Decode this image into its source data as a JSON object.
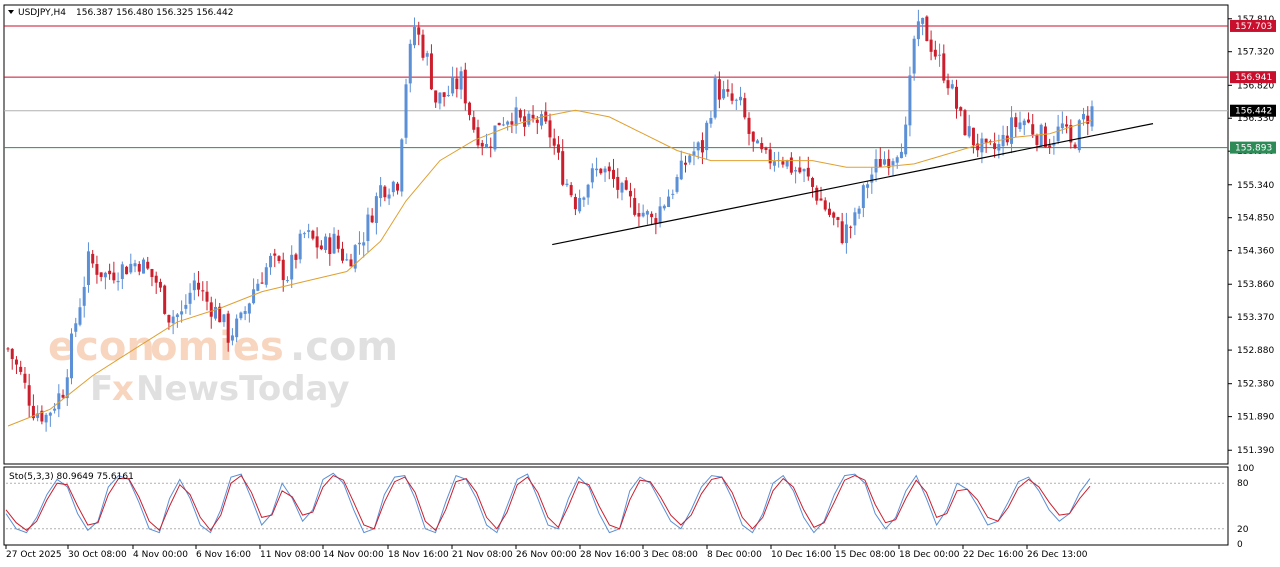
{
  "header": {
    "symbol": "USDJPY,H4",
    "ohlc": "156.387 156.480 156.325 156.442",
    "menu_icon": "triangle-down-icon"
  },
  "watermark": {
    "line1_a": "econ",
    "line1_b": "omies",
    "line1_c": ".com",
    "line2_a": "F",
    "line2_b": "x",
    "line2_c": "NewsToday"
  },
  "colors": {
    "bull": "#5b8fd6",
    "bear": "#cc1f2d",
    "ma": "#e0a030",
    "resistance": "#c8102e",
    "support": "#2e8b57",
    "price_line": "#b0b0b0",
    "stoch_main": "#5b8fd6",
    "stoch_signal": "#cc1f2d"
  },
  "chart_data": [
    {
      "type": "candlestick",
      "symbol": "USDJPY",
      "timeframe": "H4",
      "ylim": [
        151.2,
        158.0
      ],
      "y_ticks": [
        "157.810",
        "157.320",
        "156.820",
        "156.330",
        "155.840",
        "155.340",
        "154.850",
        "154.360",
        "153.860",
        "153.370",
        "152.880",
        "152.380",
        "151.890",
        "151.390"
      ],
      "x_ticks": [
        "27 Oct 2025",
        "30 Oct 08:00",
        "4 Nov 00:00",
        "6 Nov 16:00",
        "11 Nov 08:00",
        "14 Nov 00:00",
        "18 Nov 16:00",
        "21 Nov 08:00",
        "26 Nov 00:00",
        "28 Nov 16:00",
        "3 Dec 08:00",
        "8 Dec 00:00",
        "10 Dec 16:00",
        "15 Dec 08:00",
        "18 Dec 00:00",
        "22 Dec 16:00",
        "26 Dec 13:00"
      ],
      "levels": [
        {
          "value": 157.703,
          "label": "157.703",
          "kind": "resistance"
        },
        {
          "value": 156.941,
          "label": "156.941",
          "kind": "resistance"
        },
        {
          "value": 156.442,
          "label": "156.442",
          "kind": "current"
        },
        {
          "value": 155.893,
          "label": "155.893",
          "kind": "support"
        }
      ],
      "trendline": {
        "from": {
          "x": "15 Dec 08:00",
          "y": 154.45
        },
        "to": {
          "x": "29 Dec",
          "y": 156.25
        }
      },
      "close_path": [
        [
          0,
          152.9
        ],
        [
          3,
          152.5
        ],
        [
          6,
          152.0
        ],
        [
          9,
          151.9
        ],
        [
          13,
          152.3
        ],
        [
          16,
          153.3
        ],
        [
          19,
          154.2
        ],
        [
          23,
          154.0
        ],
        [
          27,
          154.1
        ],
        [
          31,
          154.2
        ],
        [
          35,
          153.9
        ],
        [
          38,
          153.4
        ],
        [
          41,
          153.4
        ],
        [
          44,
          153.9
        ],
        [
          47,
          153.6
        ],
        [
          50,
          153.4
        ],
        [
          52,
          153.1
        ],
        [
          55,
          153.3
        ],
        [
          58,
          153.8
        ],
        [
          62,
          154.2
        ],
        [
          66,
          154.0
        ],
        [
          70,
          154.6
        ],
        [
          74,
          154.4
        ],
        [
          77,
          154.5
        ],
        [
          80,
          154.2
        ],
        [
          84,
          154.6
        ],
        [
          88,
          155.3
        ],
        [
          92,
          155.4
        ],
        [
          94,
          156.9
        ],
        [
          96,
          157.7
        ],
        [
          99,
          157.2
        ],
        [
          101,
          156.6
        ],
        [
          104,
          156.7
        ],
        [
          107,
          156.9
        ],
        [
          110,
          156.2
        ],
        [
          113,
          155.9
        ],
        [
          116,
          156.3
        ],
        [
          119,
          156.4
        ],
        [
          122,
          156.2
        ],
        [
          125,
          156.3
        ],
        [
          128,
          156.1
        ],
        [
          131,
          155.5
        ],
        [
          134,
          155.1
        ],
        [
          137,
          155.4
        ],
        [
          140,
          155.6
        ],
        [
          143,
          155.4
        ],
        [
          146,
          155.1
        ],
        [
          149,
          155.0
        ],
        [
          152,
          154.8
        ],
        [
          155,
          155.1
        ],
        [
          158,
          155.4
        ],
        [
          161,
          155.8
        ],
        [
          164,
          155.9
        ],
        [
          167,
          156.8
        ],
        [
          170,
          156.6
        ],
        [
          173,
          156.5
        ],
        [
          176,
          155.9
        ],
        [
          179,
          155.7
        ],
        [
          182,
          155.8
        ],
        [
          185,
          155.6
        ],
        [
          188,
          155.5
        ],
        [
          191,
          155.2
        ],
        [
          194,
          154.9
        ],
        [
          197,
          154.6
        ],
        [
          200,
          154.8
        ],
        [
          203,
          155.4
        ],
        [
          206,
          155.7
        ],
        [
          209,
          155.8
        ],
        [
          212,
          156.1
        ],
        [
          214,
          157.5
        ],
        [
          216,
          157.7
        ],
        [
          219,
          157.3
        ],
        [
          222,
          156.9
        ],
        [
          225,
          156.3
        ],
        [
          228,
          156.0
        ],
        [
          231,
          155.8
        ],
        [
          234,
          155.9
        ],
        [
          237,
          156.2
        ],
        [
          240,
          156.3
        ],
        [
          243,
          156.1
        ],
        [
          246,
          156.0
        ],
        [
          249,
          156.2
        ],
        [
          251,
          155.9
        ],
        [
          254,
          156.3
        ],
        [
          256,
          156.45
        ]
      ],
      "ma": [
        [
          0,
          151.75
        ],
        [
          10,
          152.0
        ],
        [
          20,
          152.5
        ],
        [
          30,
          152.9
        ],
        [
          40,
          153.3
        ],
        [
          50,
          153.5
        ],
        [
          60,
          153.75
        ],
        [
          70,
          153.9
        ],
        [
          80,
          154.05
        ],
        [
          88,
          154.5
        ],
        [
          94,
          155.1
        ],
        [
          102,
          155.7
        ],
        [
          110,
          156.0
        ],
        [
          118,
          156.2
        ],
        [
          126,
          156.35
        ],
        [
          134,
          156.45
        ],
        [
          142,
          156.35
        ],
        [
          150,
          156.1
        ],
        [
          158,
          155.85
        ],
        [
          166,
          155.7
        ],
        [
          174,
          155.7
        ],
        [
          182,
          155.7
        ],
        [
          190,
          155.7
        ],
        [
          198,
          155.6
        ],
        [
          206,
          155.6
        ],
        [
          214,
          155.65
        ],
        [
          222,
          155.8
        ],
        [
          230,
          155.95
        ],
        [
          238,
          156.05
        ],
        [
          246,
          156.1
        ],
        [
          256,
          156.3
        ]
      ],
      "ma_label": ""
    },
    {
      "type": "line",
      "name": "Sto(5,3,3)",
      "legend": "Sto(5,3,3) 80.9649 75.6161",
      "ylim": [
        0,
        100
      ],
      "levels": [
        80,
        20
      ],
      "y_ticks": [
        "100",
        "80",
        "20",
        "0"
      ],
      "series": [
        {
          "name": "main",
          "values": [
            40,
            20,
            15,
            35,
            65,
            85,
            75,
            40,
            18,
            30,
            75,
            90,
            85,
            55,
            20,
            15,
            60,
            85,
            60,
            25,
            15,
            45,
            88,
            92,
            60,
            25,
            40,
            80,
            60,
            30,
            45,
            85,
            93,
            80,
            45,
            15,
            20,
            65,
            88,
            90,
            60,
            20,
            15,
            55,
            90,
            85,
            60,
            25,
            15,
            50,
            85,
            92,
            60,
            25,
            20,
            60,
            88,
            75,
            40,
            15,
            20,
            70,
            88,
            80,
            55,
            30,
            20,
            45,
            75,
            90,
            88,
            60,
            25,
            15,
            40,
            80,
            90,
            70,
            35,
            15,
            30,
            65,
            90,
            92,
            80,
            40,
            20,
            35,
            70,
            90,
            60,
            25,
            45,
            80,
            72,
            50,
            25,
            30,
            55,
            82,
            88,
            70,
            45,
            30,
            40,
            68,
            86
          ]
        },
        {
          "name": "signal",
          "values": [
            45,
            28,
            18,
            30,
            58,
            80,
            78,
            50,
            25,
            28,
            65,
            86,
            86,
            62,
            30,
            18,
            50,
            78,
            65,
            35,
            18,
            38,
            80,
            90,
            68,
            35,
            38,
            70,
            62,
            38,
            42,
            75,
            90,
            84,
            55,
            25,
            20,
            55,
            82,
            88,
            68,
            30,
            18,
            45,
            82,
            86,
            68,
            35,
            20,
            42,
            78,
            88,
            68,
            35,
            22,
            50,
            82,
            78,
            50,
            25,
            20,
            58,
            84,
            82,
            62,
            38,
            25,
            38,
            66,
            85,
            88,
            68,
            35,
            20,
            35,
            70,
            86,
            75,
            45,
            22,
            28,
            55,
            84,
            90,
            84,
            52,
            28,
            32,
            60,
            84,
            68,
            35,
            40,
            70,
            72,
            58,
            35,
            30,
            48,
            74,
            85,
            75,
            55,
            38,
            40,
            60,
            76
          ]
        }
      ]
    }
  ]
}
